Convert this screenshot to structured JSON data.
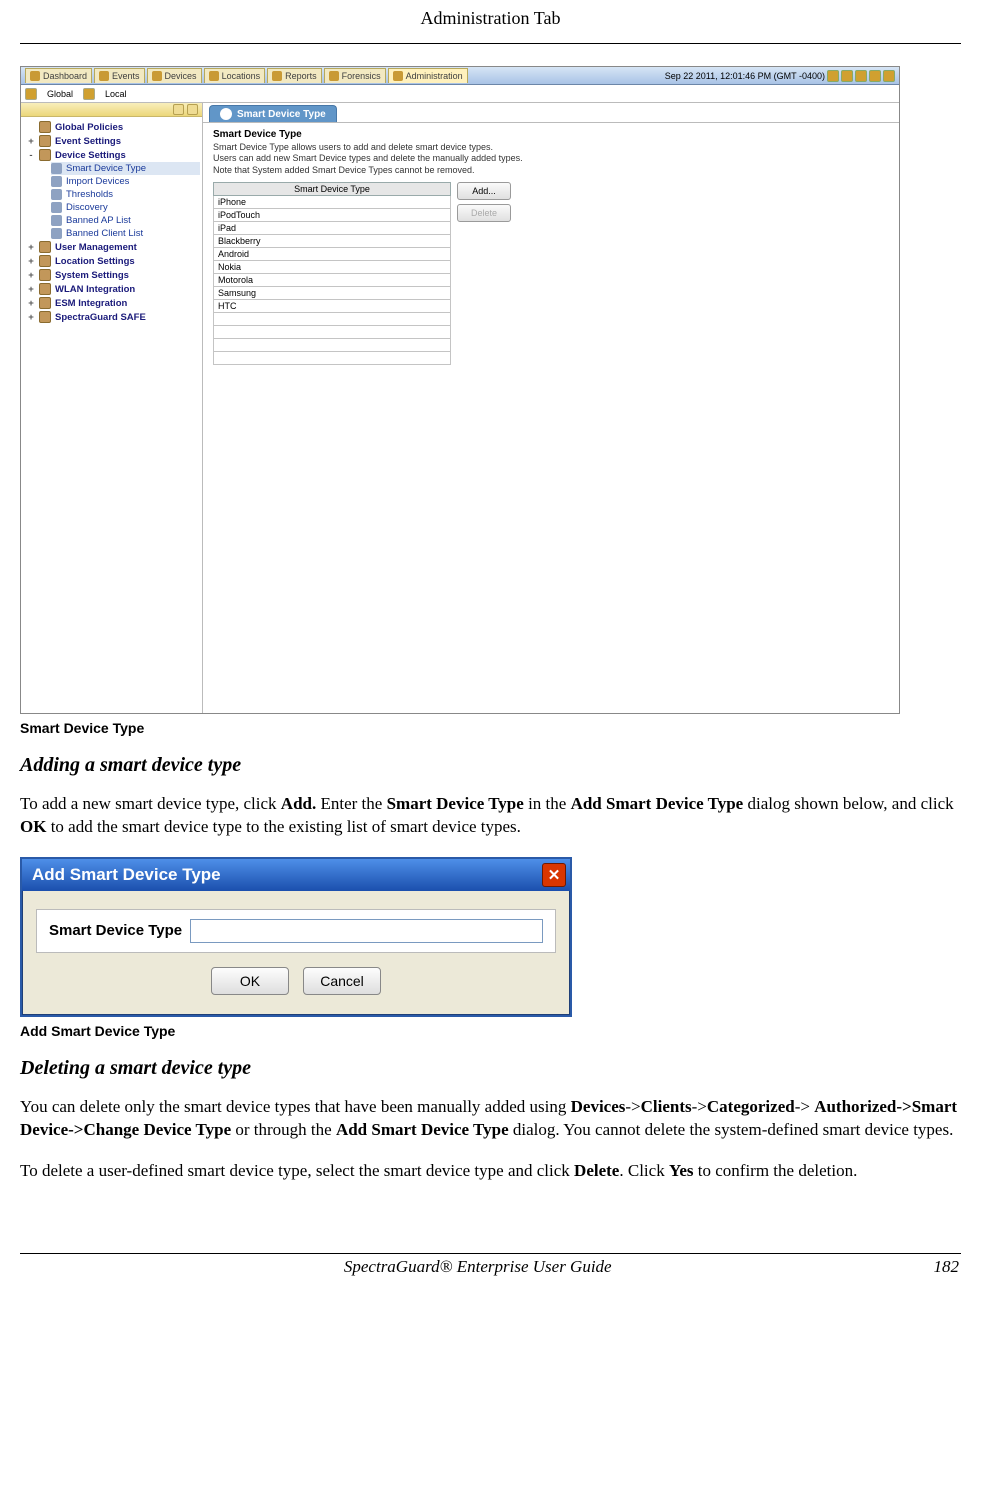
{
  "header": {
    "title": "Administration Tab"
  },
  "screenshot1_caption": "Smart Device Type",
  "app": {
    "tabs": [
      {
        "label": "Dashboard"
      },
      {
        "label": "Events"
      },
      {
        "label": "Devices"
      },
      {
        "label": "Locations"
      },
      {
        "label": "Reports"
      },
      {
        "label": "Forensics"
      },
      {
        "label": "Administration"
      }
    ],
    "timestamp": "Sep 22 2011, 12:01:46 PM (GMT -0400)",
    "subbar": {
      "global": "Global",
      "local": "Local"
    },
    "sidebar": {
      "global_policies": "Global Policies",
      "event_settings": "Event Settings",
      "device_settings": "Device Settings",
      "device_settings_children": [
        "Smart Device Type",
        "Import Devices",
        "Thresholds",
        "Discovery",
        "Banned AP List",
        "Banned Client List"
      ],
      "user_management": "User Management",
      "location_settings": "Location Settings",
      "system_settings": "System Settings",
      "wlan_integration": "WLAN Integration",
      "esm_integration": "ESM Integration",
      "spectraguard_safe": "SpectraGuard SAFE"
    },
    "panel": {
      "tab_label": "Smart Device Type",
      "heading": "Smart Device Type",
      "desc": "Smart Device Type allows users to add and delete smart device types.\nUsers can add new Smart Device types and delete the manually added types.\nNote that System added Smart Device Types cannot be removed.",
      "col_header": "Smart Device Type",
      "rows": [
        "iPhone",
        "iPodTouch",
        "iPad",
        "Blackberry",
        "Android",
        "Nokia",
        "Motorola",
        "Samsung",
        "HTC"
      ],
      "add_btn": "Add...",
      "delete_btn": "Delete"
    }
  },
  "section1_heading": "Adding a smart device type",
  "section1_para": {
    "t1": " To add a new smart device type, click ",
    "b1": "Add.",
    "t2": " Enter the ",
    "b2": "Smart Device Type",
    "t3": " in the ",
    "b3": "Add Smart Device Type",
    "t4": " dialog shown below, and click ",
    "b4": "OK",
    "t5": "  to add the smart device type to the existing list of smart device types."
  },
  "dialog": {
    "title": "Add Smart Device Type",
    "field_label": "Smart Device Type",
    "ok": "OK",
    "cancel": "Cancel"
  },
  "screenshot2_caption": "Add Smart Device Type",
  "section2_heading": "Deleting a smart device type",
  "section2_para1": {
    "t1": "You can delete only the smart device types that have been manually added using  ",
    "b1": "Devices",
    "t2": "->",
    "b2": "Clients",
    "t3": "->",
    "b3": "Categorized",
    "t4": "-> ",
    "b4": "Authorized->Smart Device->Change Device Type",
    "t5": " or through the ",
    "b5": "Add Smart Device Type",
    "t6": " dialog. You cannot delete the system-defined smart device types."
  },
  "section2_para2": {
    "t1": "To delete a user-defined smart device type, select the smart device type and click ",
    "b1": "Delete",
    "t2": ". Click ",
    "b2": "Yes",
    "t3": " to confirm the deletion."
  },
  "footer": {
    "title": "SpectraGuard®  Enterprise User Guide",
    "page": "182"
  }
}
